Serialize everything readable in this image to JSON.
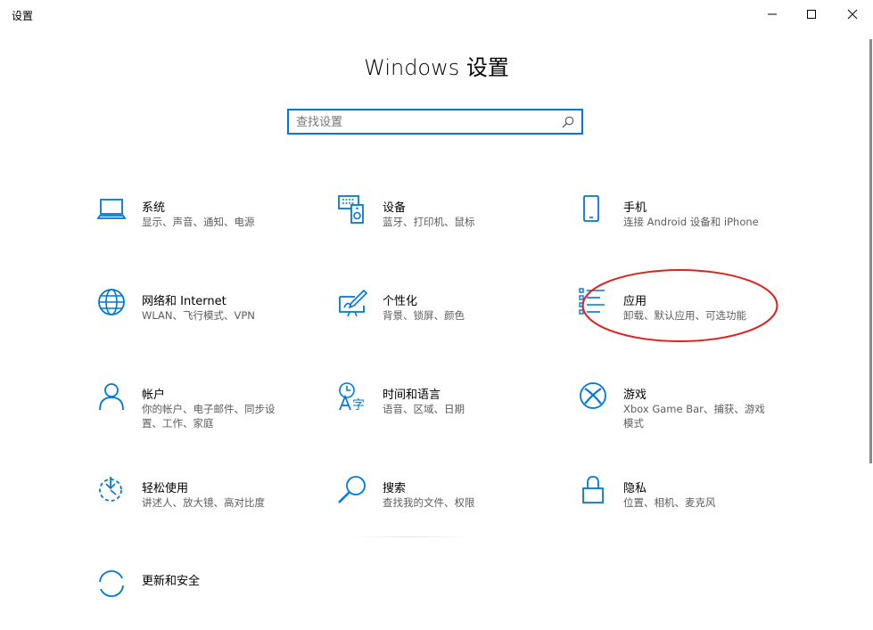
{
  "window": {
    "title": "设置",
    "controls": {
      "minimize": "minimize-icon",
      "maximize": "maximize-icon",
      "close": "close-icon"
    }
  },
  "header": {
    "title": "Windows 设置"
  },
  "search": {
    "placeholder": "查找设置",
    "value": ""
  },
  "tiles": [
    {
      "name": "系统",
      "desc": "显示、声音、通知、电源",
      "icon": "laptop-icon"
    },
    {
      "name": "设备",
      "desc": "蓝牙、打印机、鼠标",
      "icon": "devices-icon"
    },
    {
      "name": "手机",
      "desc": "连接 Android 设备和 iPhone",
      "icon": "phone-icon"
    },
    {
      "name": "网络和 Internet",
      "desc": "WLAN、飞行模式、VPN",
      "icon": "globe-icon"
    },
    {
      "name": "个性化",
      "desc": "背景、锁屏、颜色",
      "icon": "personalization-icon"
    },
    {
      "name": "应用",
      "desc": "卸载、默认应用、可选功能",
      "icon": "apps-list-icon"
    },
    {
      "name": "帐户",
      "desc": "你的帐户、电子邮件、同步设置、工作、家庭",
      "icon": "person-icon"
    },
    {
      "name": "时间和语言",
      "desc": "语音、区域、日期",
      "icon": "time-language-icon"
    },
    {
      "name": "游戏",
      "desc": "Xbox Game Bar、捕获、游戏模式",
      "icon": "xbox-icon"
    },
    {
      "name": "轻松使用",
      "desc": "讲述人、放大镜、高对比度",
      "icon": "ease-of-access-icon"
    },
    {
      "name": "搜索",
      "desc": "查找我的文件、权限",
      "icon": "search-magnifier-icon"
    },
    {
      "name": "隐私",
      "desc": "位置、相机、麦克风",
      "icon": "lock-icon"
    },
    {
      "name": "更新和安全",
      "desc": "",
      "icon": "update-icon"
    }
  ],
  "colors": {
    "accent": "#0078d7",
    "annotation": "#e0201b"
  }
}
